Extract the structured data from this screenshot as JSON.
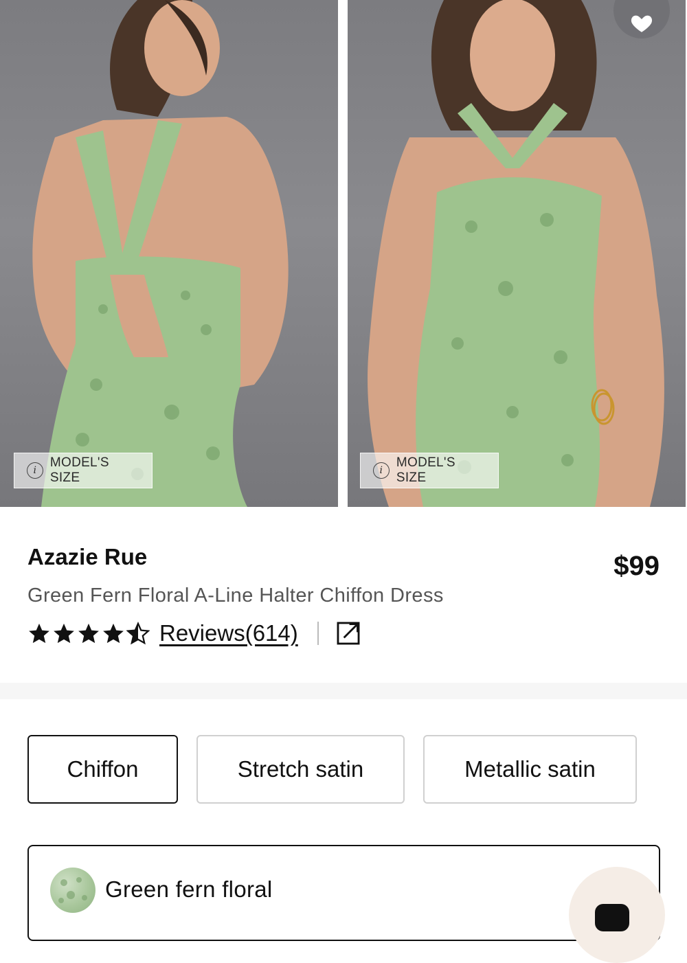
{
  "gallery": {
    "model_size_label": "MODEL'S SIZE",
    "info_glyph": "i",
    "favorite_icon": "heart-icon"
  },
  "product": {
    "brand": "Azazie Rue",
    "price": "$99",
    "name": "Green Fern Floral A-Line Halter Chiffon Dress",
    "rating": 4.5,
    "reviews_label": "Reviews(614)",
    "share_icon": "external-link-icon"
  },
  "fabrics": {
    "options": [
      "Chiffon",
      "Stretch satin",
      "Metallic satin"
    ],
    "selected": "Chiffon"
  },
  "color": {
    "label": "Green fern floral",
    "swatch_color": "#a9c79c"
  },
  "colors": {
    "dress_green": "#9ec38e",
    "background_gray": "#808084",
    "text_muted": "#555555"
  }
}
